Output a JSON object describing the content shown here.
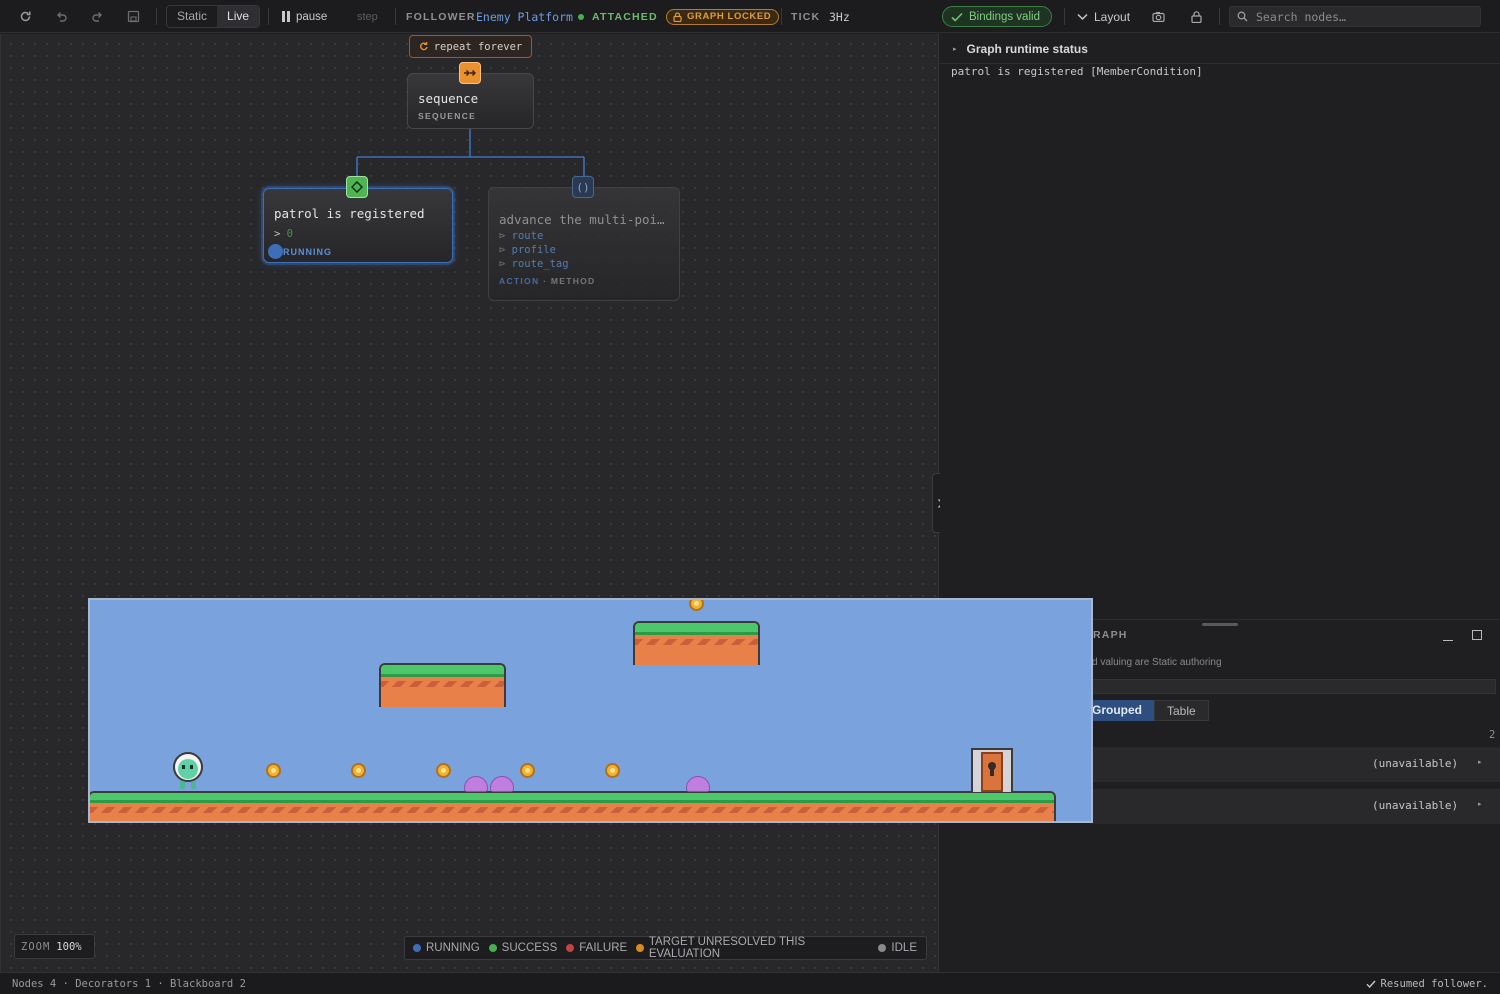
{
  "toolbar": {
    "mode_static": "Static",
    "mode_live": "Live",
    "pause_label": "pause",
    "step_label": "step",
    "follower_label": "FOLLOWER",
    "follower_target": "Enemy Platform",
    "attached_label": "ATTACHED",
    "graph_locked_label": "GRAPH LOCKED",
    "tick_label": "TICK",
    "tick_value": "3Hz",
    "bindings_label": "Bindings valid",
    "layout_label": "Layout",
    "search_placeholder": "Search nodes…"
  },
  "graph": {
    "decorator": {
      "label": "repeat forever"
    },
    "sequence": {
      "title": "sequence",
      "type": "SEQUENCE"
    },
    "condition": {
      "title": "patrol is registered",
      "expr_op": ">",
      "expr_val": "0",
      "status": "RUNNING"
    },
    "action": {
      "title": "advance the multi-poi…",
      "props": [
        "route",
        "profile",
        "route_tag"
      ],
      "type": "ACTION",
      "subtype": "· METHOD"
    }
  },
  "zoom": {
    "label": "ZOOM",
    "value": "100%"
  },
  "legend": [
    {
      "label": "RUNNING",
      "color": "#3d6fb8"
    },
    {
      "label": "SUCCESS",
      "color": "#46b04e"
    },
    {
      "label": "FAILURE",
      "color": "#c0453e"
    },
    {
      "label": "TARGET UNRESOLVED THIS EVALUATION",
      "color": "#d98a1e"
    },
    {
      "label": "IDLE",
      "color": "#8a8a8e"
    }
  ],
  "right_panel": {
    "runtime_title": "Graph runtime status",
    "runtime_line": "patrol is registered [MemberCondition]",
    "bb_title_frag": "RAPH",
    "bb_desc_frag": "d valuing are Static authoring",
    "tab_grouped": "Grouped",
    "tab_table": "Table",
    "count": "2",
    "rows": [
      {
        "value": "(unavailable)"
      },
      {
        "value": "(unavailable)"
      }
    ]
  },
  "statusbar": {
    "left": "Nodes 4 · Decorators 1 · Blackboard 2",
    "right": "Resumed follower."
  },
  "colors": {
    "accent": "#3d6fb8",
    "sequence": "#e8912e",
    "condition": "#4fb552",
    "locked": "#e09b3d"
  }
}
